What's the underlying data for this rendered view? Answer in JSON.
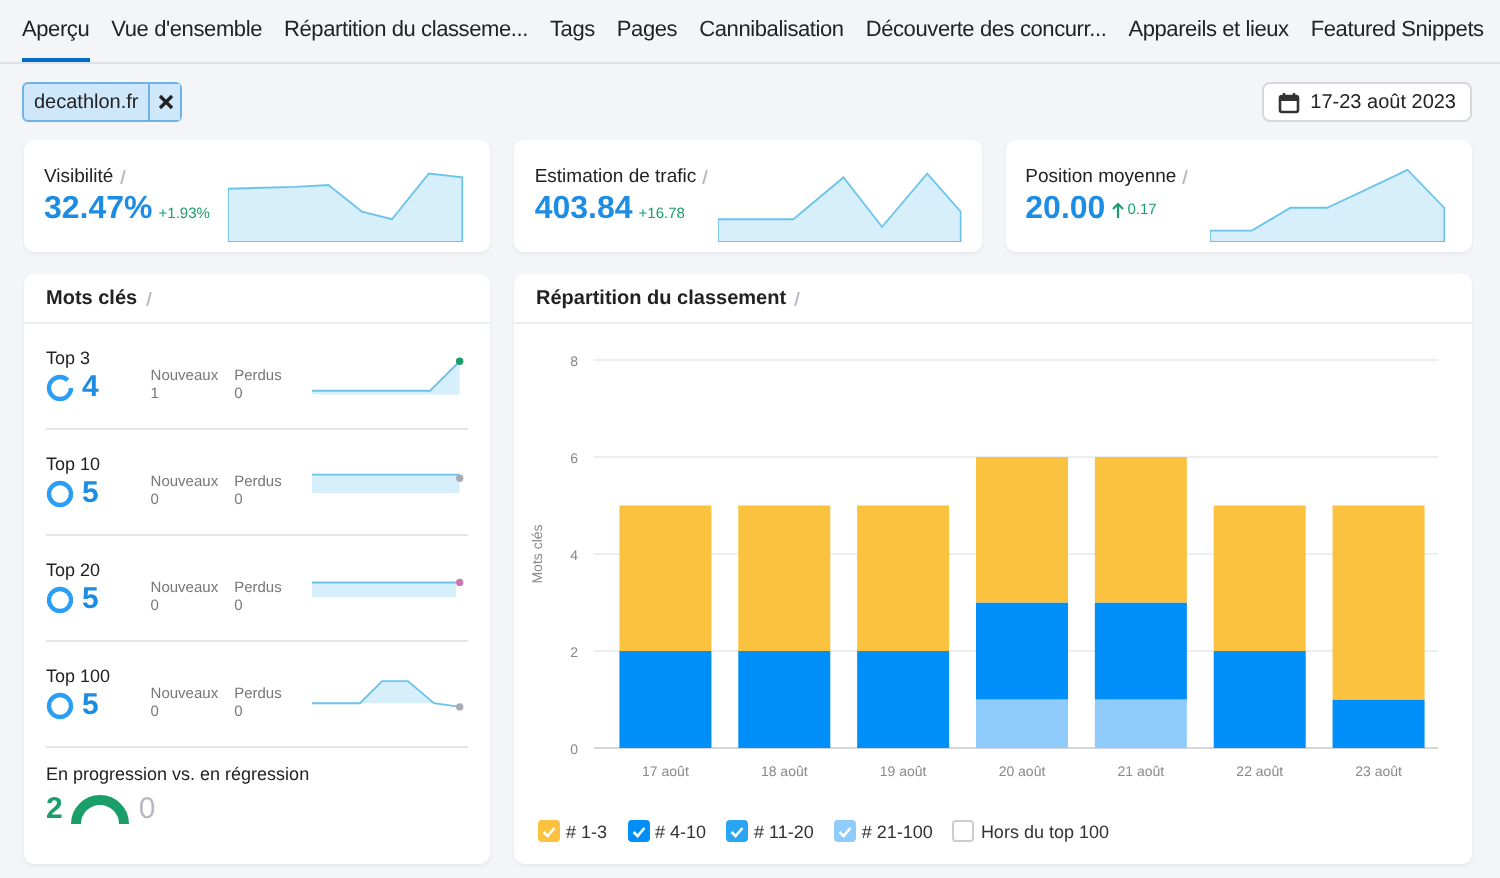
{
  "tabs": [
    {
      "label": "Aperçu",
      "selected": true
    },
    {
      "label": "Vue d'ensemble",
      "selected": false
    },
    {
      "label": "Répartition du classeme...",
      "selected": false
    },
    {
      "label": "Tags",
      "selected": false
    },
    {
      "label": "Pages",
      "selected": false
    },
    {
      "label": "Cannibalisation",
      "selected": false
    },
    {
      "label": "Découverte des concurr...",
      "selected": false
    },
    {
      "label": "Appareils et lieux",
      "selected": false
    },
    {
      "label": "Featured Snippets",
      "selected": false
    }
  ],
  "filter": {
    "domain": "decathlon.fr",
    "date_range": "17-23 août 2023"
  },
  "metrics": [
    {
      "label": "Visibilité",
      "value": "32.47%",
      "change": "+1.93%",
      "arrow": false
    },
    {
      "label": "Estimation de trafic",
      "value": "403.84",
      "change": "+16.78",
      "arrow": false
    },
    {
      "label": "Position moyenne",
      "value": "20.00",
      "change": "0.17",
      "arrow": true
    }
  ],
  "keywords": {
    "title": "Mots clés",
    "rows": [
      {
        "label": "Top 3",
        "value": "4",
        "new_label": "Nouveaux",
        "new_value": "1",
        "lost_label": "Perdus",
        "lost_value": "0"
      },
      {
        "label": "Top 10",
        "value": "5",
        "new_label": "Nouveaux",
        "new_value": "0",
        "lost_label": "Perdus",
        "lost_value": "0"
      },
      {
        "label": "Top 20",
        "value": "5",
        "new_label": "Nouveaux",
        "new_value": "0",
        "lost_label": "Perdus",
        "lost_value": "0"
      },
      {
        "label": "Top 100",
        "value": "5",
        "new_label": "Nouveaux",
        "new_value": "0",
        "lost_label": "Perdus",
        "lost_value": "0"
      }
    ],
    "progress_title": "En progression vs. en régression",
    "improved": "2",
    "declined": "0"
  },
  "ranking": {
    "title": "Répartition du classement",
    "chart_data": {
      "type": "bar",
      "stacked": true,
      "grid": true,
      "ylabel": "Mots clés",
      "categories": [
        "17 août",
        "18 août",
        "19 août",
        "20 août",
        "21 août",
        "22 août",
        "23 août"
      ],
      "ylim": [
        0,
        8
      ],
      "yticks": [
        0,
        2,
        4,
        6,
        8
      ],
      "series": [
        {
          "name": "# 1-3",
          "color": "#fbc23f",
          "values": [
            3,
            3,
            3,
            3,
            3,
            3,
            4
          ]
        },
        {
          "name": "# 4-10",
          "color": "#008ff8",
          "values": [
            2,
            2,
            2,
            2,
            2,
            2,
            1
          ]
        },
        {
          "name": "# 11-20",
          "color": "#2aa5f5",
          "values": [
            0,
            0,
            0,
            0,
            0,
            0,
            0
          ]
        },
        {
          "name": "# 21-100",
          "color": "#8fccfc",
          "values": [
            0,
            0,
            0,
            1,
            1,
            0,
            0
          ]
        }
      ]
    },
    "legend": [
      {
        "checked": true
      },
      {
        "checked": true
      },
      {
        "checked": true
      },
      {
        "checked": true
      }
    ],
    "legend_extra": {
      "label": "Hors du top 100",
      "checked": false
    }
  }
}
